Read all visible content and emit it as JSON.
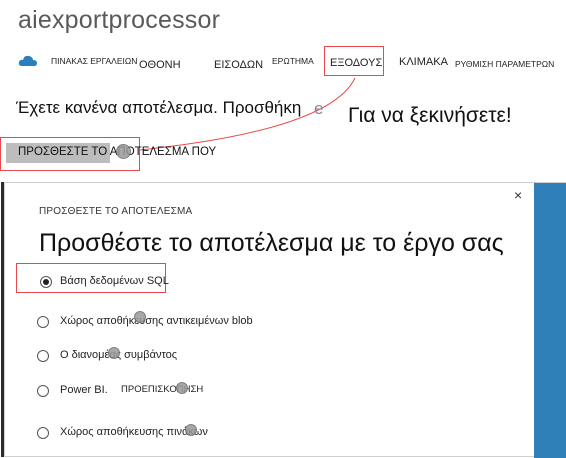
{
  "header": {
    "app_title": "aiexportprocessor"
  },
  "nav": {
    "items": [
      {
        "label": "ΠΙΝΑΚΑΣ ΕΡΓΑΛΕΙΩΝ"
      },
      {
        "label": "ΟΘΟΝΗ"
      },
      {
        "label": "ΕΙΣΟΔΩΝ"
      },
      {
        "label": "ΕΡΩΤΗΜΑ"
      },
      {
        "label": "ΕΞΟΔΟΥΣ"
      },
      {
        "label": "ΚΛΙΜΑΚΑ"
      },
      {
        "label": "ΡΥΘΜΙΣΗ ΠΑΡΑΜΕΤΡΩΝ"
      }
    ],
    "highlight_color": "#e8484b"
  },
  "main": {
    "headline_left": "Έχετε κανένα αποτέλεσμα. Προσθήκη",
    "headline_ghost": "e",
    "headline_right": "Για να ξεκινήσετε!",
    "add_output_link": "ΠΡΟΣΘΕΣΤΕ ΤΟ ΑΠΟΤΕΛΕΣΜΑ ΠΟΥ"
  },
  "dialog": {
    "subtitle": "ΠΡΟΣΘΕΣΤΕ ΤΟ ΑΠΟΤΕΛΕΣΜΑ",
    "title": "Προσθέστε το αποτέλεσμα με το έργο σας",
    "close_glyph": "×",
    "accent_color": "#2f80b8",
    "options": [
      {
        "label": "Βάση δεδομένων SQL",
        "selected": true
      },
      {
        "label": "Χώρος αποθήκευσης αντικειμένων blob",
        "selected": false
      },
      {
        "label": "Ο διανομέας συμβάντος",
        "selected": false
      },
      {
        "label": "Power BI.",
        "extra": "ΠΡΟΕΠΙΣΚΟΠΗΣΗ",
        "selected": false
      },
      {
        "label": "Χώρος αποθήκευσης πινάκων",
        "selected": false
      }
    ]
  }
}
